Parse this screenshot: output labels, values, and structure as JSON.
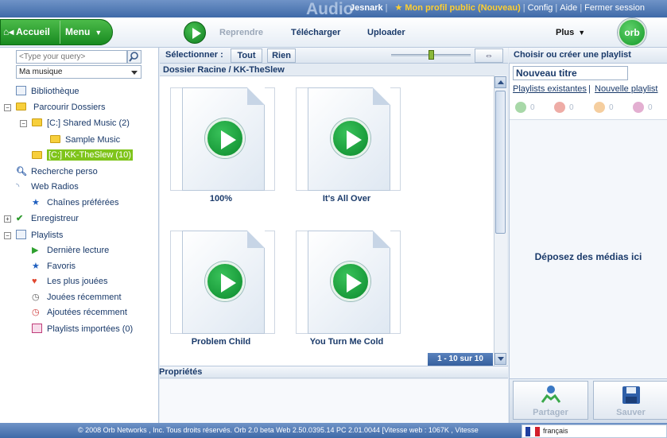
{
  "header": {
    "app_title": "Audio",
    "username": "Jesnark",
    "profile_link": "Mon profil public (Nouveau)",
    "config_link": "Config",
    "help_link": "Aide",
    "logout_link": "Fermer session"
  },
  "nav": {
    "home_label": "Accueil",
    "menu_label": "Menu",
    "resume_label": "Reprendre",
    "download_label": "Télécharger",
    "upload_label": "Uploader",
    "more_label": "Plus",
    "logo_text": "orb"
  },
  "left": {
    "search_placeholder": "<Type your query>",
    "source_selected": "Ma musique",
    "tree": [
      {
        "label": "Bibliothèque"
      },
      {
        "label": "Parcourir Dossiers"
      },
      {
        "label": "[C:] Shared Music (2)"
      },
      {
        "label": "Sample Music"
      },
      {
        "label": "[C:] KK-TheSlew (10)"
      },
      {
        "label": "Recherche perso"
      },
      {
        "label": "Web Radios"
      },
      {
        "label": "Chaînes préférées"
      },
      {
        "label": "Enregistreur"
      },
      {
        "label": "Playlists"
      },
      {
        "label": "Dernière lecture"
      },
      {
        "label": "Favoris"
      },
      {
        "label": "Les plus jouées"
      },
      {
        "label": "Jouées récemment"
      },
      {
        "label": "Ajoutées récemment"
      },
      {
        "label": "Playlists importées (0)"
      }
    ]
  },
  "toolbar": {
    "select_label": "Sélectionner :",
    "all_label": "Tout",
    "none_label": "Rien"
  },
  "main": {
    "breadcrumb": "Dossier Racine / KK-TheSlew",
    "items": [
      {
        "title": "100%"
      },
      {
        "title": "It's All Over"
      },
      {
        "title": "Problem Child"
      },
      {
        "title": "You Turn Me Cold"
      }
    ],
    "pager": "1 - 10 sur 10",
    "properties_title": "Propriétés"
  },
  "right": {
    "title": "Choisir ou créer une playlist",
    "new_title_value": "Nouveau titre",
    "existing_link": "Playlists existantes",
    "new_link": "Nouvelle playlist",
    "media_counts": [
      "0",
      "0",
      "0",
      "0"
    ],
    "drop_text": "Déposez des médias ici",
    "share_label": "Partager",
    "save_label": "Sauver"
  },
  "footer": {
    "text": "© 2008  Orb Networks , Inc. Tous droits réservés. Orb 2.0 beta  Web 2.50.0395.14  PC 2.01.0044  [Vitesse web :  1067K  , Vitesse",
    "language": "français"
  }
}
